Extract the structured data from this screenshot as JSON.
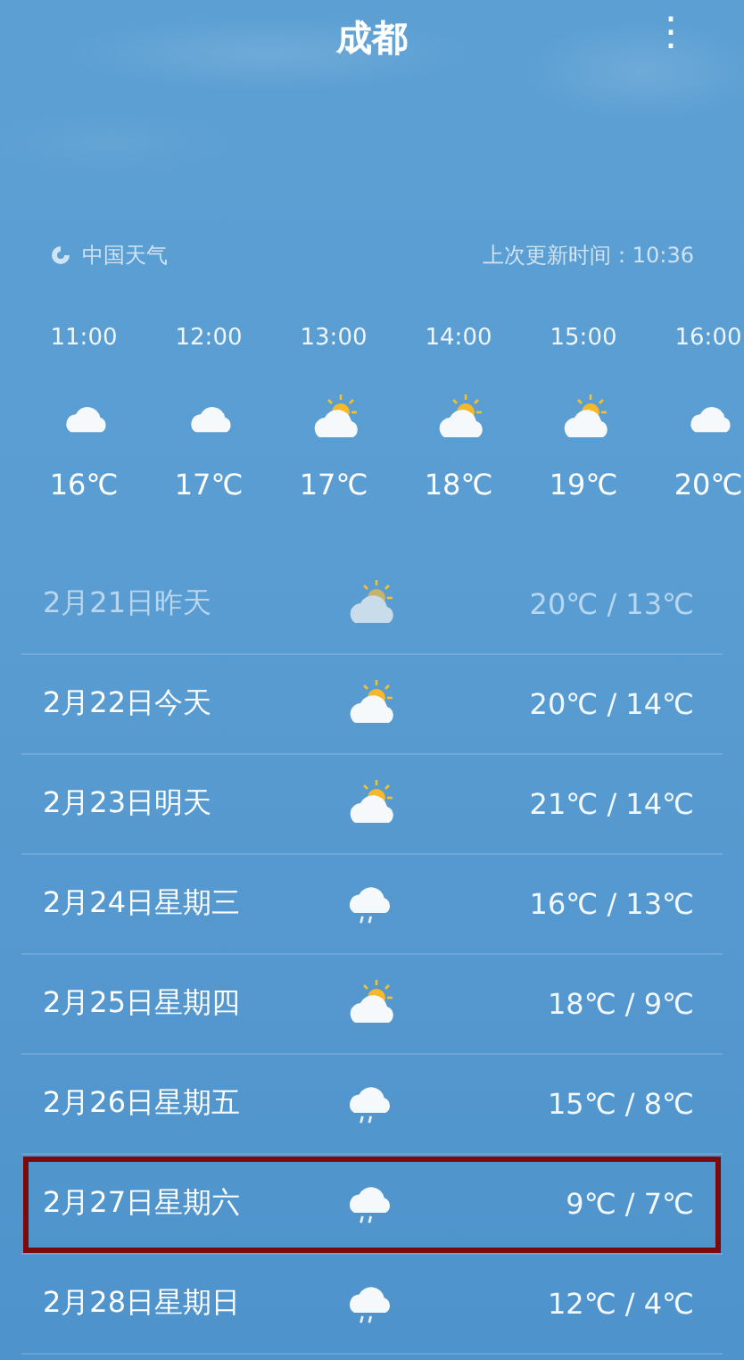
{
  "header": {
    "title": "成都",
    "menu_icon": "⋮"
  },
  "source": {
    "name": "中国天气",
    "updated": "上次更新时间：10:36"
  },
  "hourly": [
    {
      "time": "11:00",
      "kind": "cloudy",
      "temp": "16℃"
    },
    {
      "time": "12:00",
      "kind": "cloudy",
      "temp": "17℃"
    },
    {
      "time": "13:00",
      "kind": "partly-cloudy",
      "temp": "17℃"
    },
    {
      "time": "14:00",
      "kind": "partly-cloudy",
      "temp": "18℃"
    },
    {
      "time": "15:00",
      "kind": "partly-cloudy",
      "temp": "19℃"
    },
    {
      "time": "16:00",
      "kind": "cloudy",
      "temp": "20℃"
    }
  ],
  "daily": [
    {
      "date": "2月21日昨天",
      "kind": "partly-cloudy",
      "range": "20℃ / 13℃",
      "past": true,
      "highlighted": false
    },
    {
      "date": "2月22日今天",
      "kind": "partly-cloudy",
      "range": "20℃ / 14℃",
      "past": false,
      "highlighted": false
    },
    {
      "date": "2月23日明天",
      "kind": "partly-cloudy",
      "range": "21℃ / 14℃",
      "past": false,
      "highlighted": false
    },
    {
      "date": "2月24日星期三",
      "kind": "rain",
      "range": "16℃ / 13℃",
      "past": false,
      "highlighted": false
    },
    {
      "date": "2月25日星期四",
      "kind": "partly-cloudy",
      "range": "18℃ / 9℃",
      "past": false,
      "highlighted": false
    },
    {
      "date": "2月26日星期五",
      "kind": "rain",
      "range": "15℃ / 8℃",
      "past": false,
      "highlighted": false
    },
    {
      "date": "2月27日星期六",
      "kind": "rain",
      "range": "9℃ / 7℃",
      "past": false,
      "highlighted": true
    },
    {
      "date": "2月28日星期日",
      "kind": "rain",
      "range": "12℃ / 4℃",
      "past": false,
      "highlighted": false
    }
  ]
}
